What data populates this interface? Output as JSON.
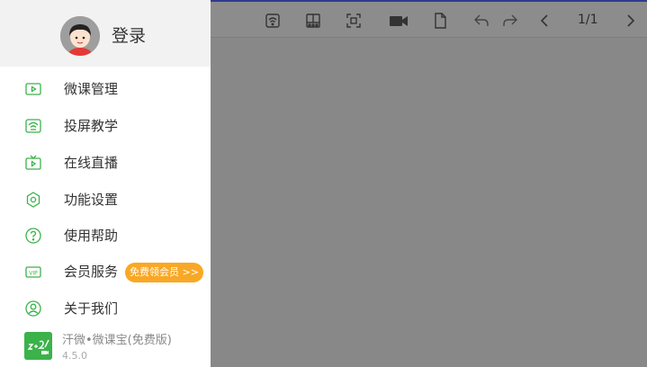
{
  "sidebar": {
    "login_label": "登录",
    "menu": [
      {
        "label": "微课管理",
        "icon": "video-play-icon"
      },
      {
        "label": "投屏教学",
        "icon": "screencast-icon"
      },
      {
        "label": "在线直播",
        "icon": "live-tv-icon"
      },
      {
        "label": "功能设置",
        "icon": "settings-gear-icon"
      },
      {
        "label": "使用帮助",
        "icon": "help-question-icon"
      },
      {
        "label": "会员服务",
        "icon": "vip-icon"
      },
      {
        "label": "关于我们",
        "icon": "user-circle-icon"
      }
    ],
    "vip_badge": "免费领会员 >>",
    "app": {
      "name": "汗微•微课宝(免费版)",
      "version": "4.5.0"
    }
  },
  "toolbar": {
    "page_indicator": "1/1"
  },
  "colors": {
    "accent_green": "#3cb24b",
    "badge_orange": "#f9a825",
    "canvas_gray": "#888888"
  }
}
